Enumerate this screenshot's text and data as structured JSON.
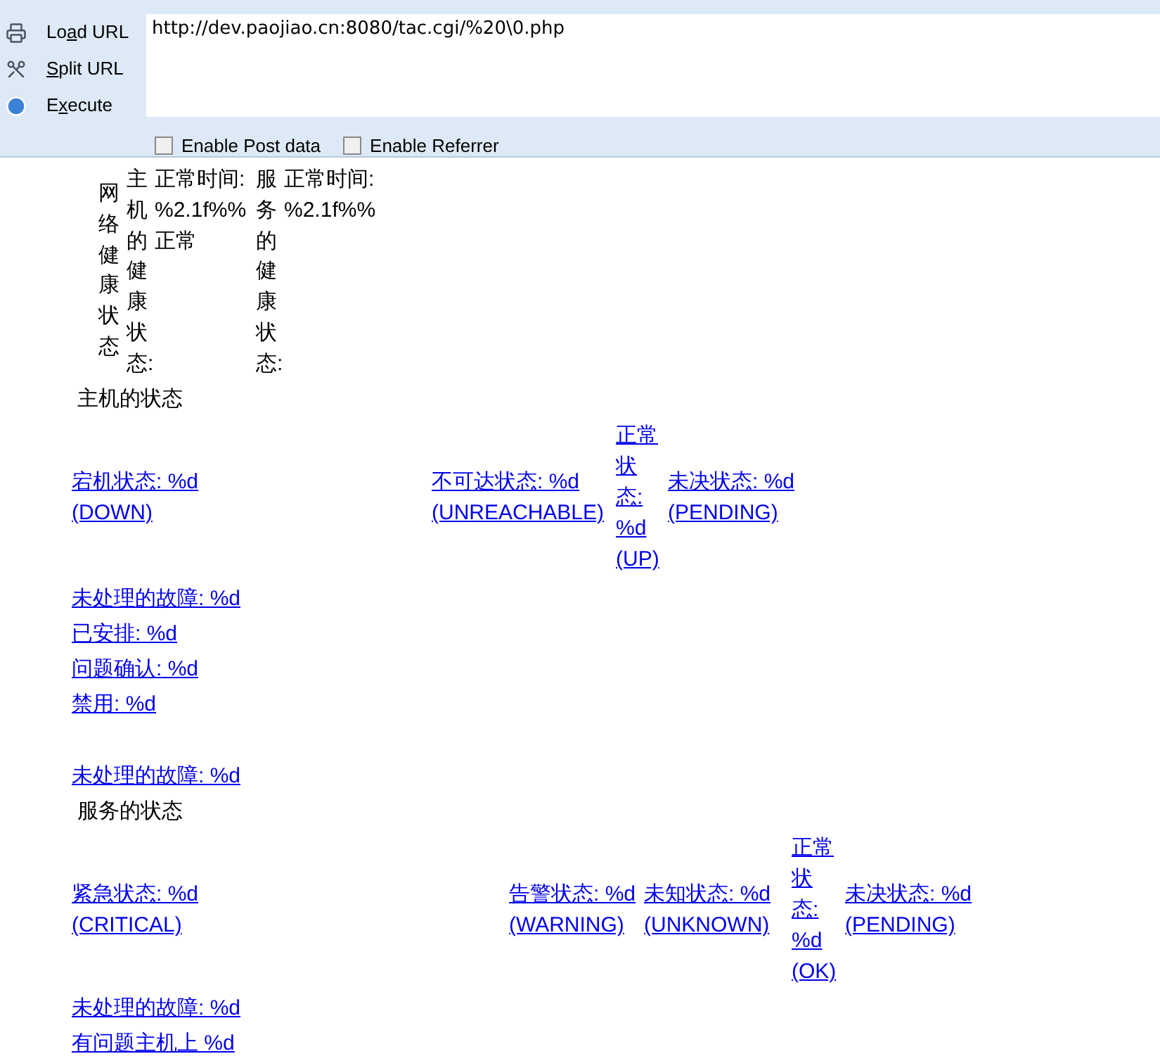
{
  "toolbar": {
    "buttons": [
      {
        "kind": "load",
        "pre": "Lo",
        "key": "a",
        "post": "d URL"
      },
      {
        "kind": "split",
        "key": "S",
        "post": "plit URL"
      },
      {
        "kind": "execute",
        "pre": "E",
        "key": "x",
        "post": "ecute"
      }
    ],
    "url": "http://dev.paojiao.cn:8080/tac.cgi/%20\\0.php",
    "options": [
      {
        "label": "Enable Post data",
        "checked": false
      },
      {
        "label": "Enable Referrer",
        "checked": false
      }
    ]
  },
  "health": {
    "title": "网络健康状态",
    "columns": [
      {
        "label": "主机的健康状态:",
        "value": "正常时间: %2.1f%% 正常"
      },
      {
        "label": "服务的健康状态:",
        "value": "正常时间: %2.1f%%"
      }
    ]
  },
  "host_status": {
    "title": "主机的状态",
    "states": [
      "宕机状态: %d (DOWN)",
      "不可达状态: %d (UNREACHABLE)",
      "正常状态: %d (UP)",
      "未决状态: %d (PENDING)"
    ],
    "problems": [
      "未处理的故障: %d",
      "已安排: %d",
      "问题确认: %d",
      "禁用: %d"
    ],
    "more": [
      "未处理的故障: %d"
    ]
  },
  "service_status": {
    "title": "服务的状态",
    "states": [
      "紧急状态: %d (CRITICAL)",
      "告警状态: %d (WARNING)",
      "未知状态: %d (UNKNOWN)",
      "正常状态: %d (OK)",
      "未决状态: %d (PENDING)"
    ],
    "problems": [
      "未处理的故障: %d",
      "有问题主机上 %d"
    ]
  }
}
